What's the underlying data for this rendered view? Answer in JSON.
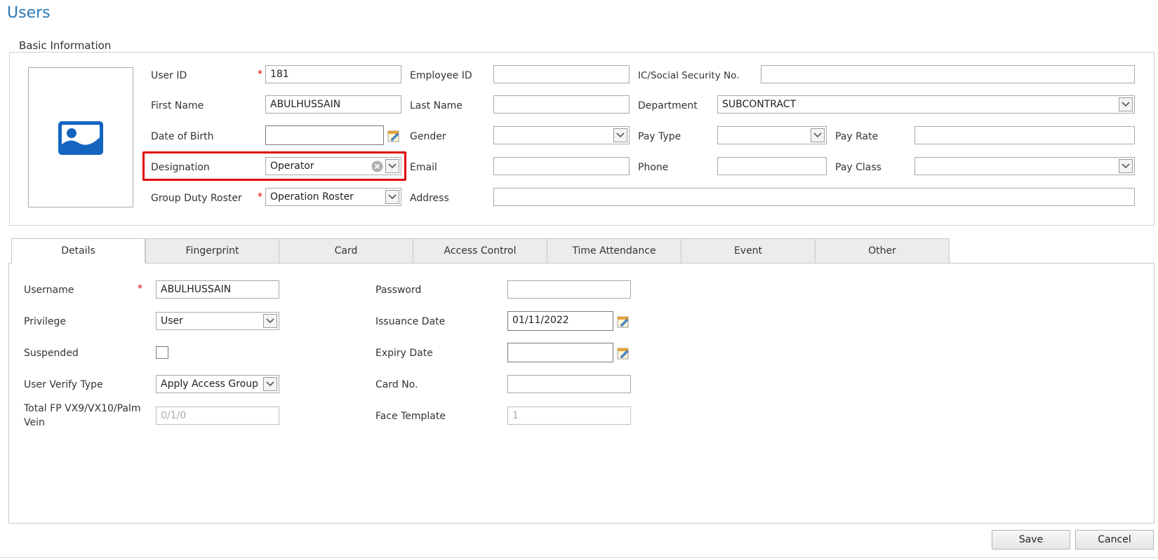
{
  "page": {
    "title": "Users"
  },
  "basic_info": {
    "legend": "Basic Information",
    "user_id": {
      "label": "User ID",
      "value": "181"
    },
    "employee_id": {
      "label": "Employee ID",
      "value": ""
    },
    "ic_ssn": {
      "label": "IC/Social Security No.",
      "value": ""
    },
    "first_name": {
      "label": "First Name",
      "value": "ABULHUSSAIN"
    },
    "last_name": {
      "label": "Last Name",
      "value": ""
    },
    "department": {
      "label": "Department",
      "value": "SUBCONTRACT"
    },
    "dob": {
      "label": "Date of Birth",
      "value": ""
    },
    "gender": {
      "label": "Gender",
      "value": ""
    },
    "pay_type": {
      "label": "Pay Type",
      "value": ""
    },
    "pay_rate": {
      "label": "Pay Rate",
      "value": ""
    },
    "designation": {
      "label": "Designation",
      "value": "Operator"
    },
    "email": {
      "label": "Email",
      "value": ""
    },
    "phone": {
      "label": "Phone",
      "value": ""
    },
    "pay_class": {
      "label": "Pay Class",
      "value": ""
    },
    "group_duty_roster": {
      "label": "Group Duty Roster",
      "value": "Operation Roster"
    },
    "address": {
      "label": "Address",
      "value": ""
    },
    "required_mark": "*"
  },
  "tabs": [
    {
      "label": "Details"
    },
    {
      "label": "Fingerprint"
    },
    {
      "label": "Card"
    },
    {
      "label": "Access Control"
    },
    {
      "label": "Time Attendance"
    },
    {
      "label": "Event"
    },
    {
      "label": "Other"
    }
  ],
  "details": {
    "username": {
      "label": "Username",
      "value": "ABULHUSSAIN"
    },
    "password": {
      "label": "Password",
      "value": ""
    },
    "privilege": {
      "label": "Privilege",
      "value": "User"
    },
    "issuance_date": {
      "label": "Issuance Date",
      "value": "01/11/2022"
    },
    "suspended": {
      "label": "Suspended"
    },
    "expiry_date": {
      "label": "Expiry Date",
      "value": ""
    },
    "user_verify_type": {
      "label": "User Verify Type",
      "value": "Apply Access Group"
    },
    "card_no": {
      "label": "Card No.",
      "value": ""
    },
    "total_fp": {
      "label_line1": "Total FP VX9/VX10/Palm",
      "label_line2": "Vein",
      "value": "0/1/0"
    },
    "face_template": {
      "label": "Face Template",
      "value": "1"
    }
  },
  "actions": {
    "save": "Save",
    "cancel": "Cancel"
  },
  "colors": {
    "title": "#2a7ab8",
    "highlight": "#e00000",
    "photo_icon": "#1565c0"
  }
}
